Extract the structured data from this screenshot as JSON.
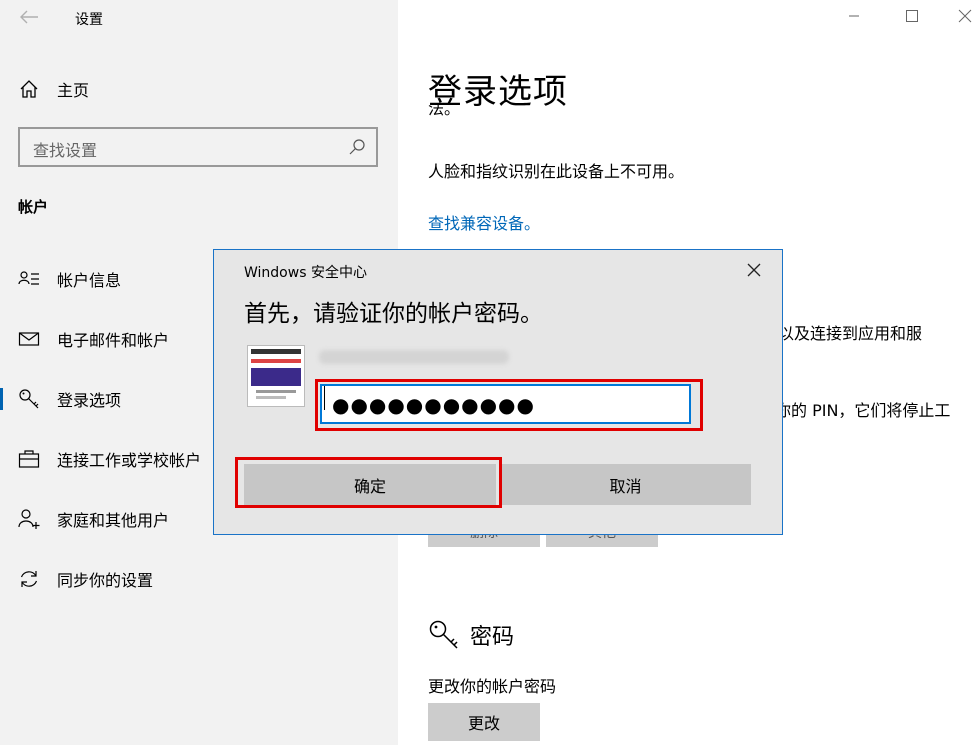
{
  "window": {
    "title": "设置"
  },
  "sidebar": {
    "home_label": "主页",
    "search_placeholder": "查找设置",
    "section_title": "帐户",
    "items": [
      {
        "label": "帐户信息",
        "icon": "account-info-icon"
      },
      {
        "label": "电子邮件和帐户",
        "icon": "mail-icon"
      },
      {
        "label": "登录选项",
        "icon": "key-icon",
        "active": true
      },
      {
        "label": "连接工作或学校帐户",
        "icon": "briefcase-icon"
      },
      {
        "label": "家庭和其他用户",
        "icon": "add-user-icon"
      },
      {
        "label": "同步你的设置",
        "icon": "sync-icon"
      }
    ]
  },
  "main": {
    "title": "登录选项",
    "cut_text": "法。",
    "face_finger_text": "人脸和指纹识别在此设备上不可用。",
    "find_devices_link": "查找兼容设备。",
    "partial_text_1": "以及连接到应用和服",
    "partial_text_2": "你的 PIN，它们将停止工",
    "hidden_button_1": "删除",
    "hidden_button_2": "其他",
    "password_heading": "密码",
    "password_desc": "更改你的帐户密码",
    "change_button": "更改"
  },
  "dialog": {
    "title": "Windows 安全中心",
    "heading": "首先，请验证你的帐户密码。",
    "password_value": "●●●●●●●●●●●",
    "ok_label": "确定",
    "cancel_label": "取消"
  },
  "colors": {
    "accent": "#0078d7",
    "link": "#0067b8",
    "highlight": "#e00000",
    "sidebar_bg": "#f2f2f2",
    "dialog_bg": "#e6e6e6"
  }
}
